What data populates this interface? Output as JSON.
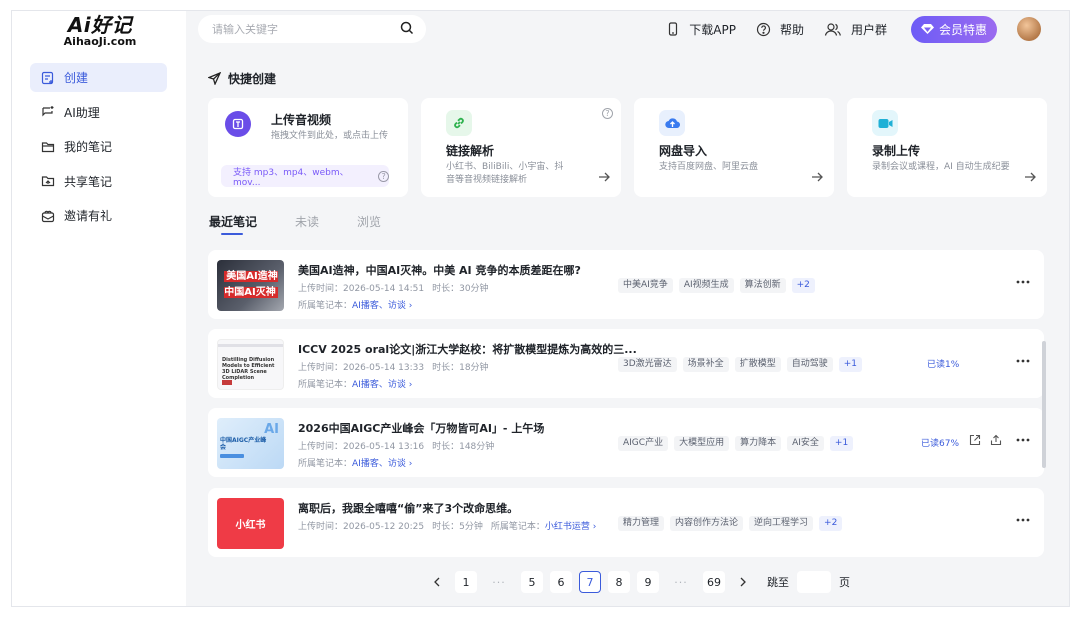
{
  "logo": {
    "mark": "Ai好记",
    "domain": "AihaoJi.com"
  },
  "sidebar": {
    "items": [
      {
        "label": "创建",
        "icon": "create-icon",
        "active": true
      },
      {
        "label": "AI助理",
        "icon": "ai-assistant-icon",
        "active": false
      },
      {
        "label": "我的笔记",
        "icon": "folder-icon",
        "active": false
      },
      {
        "label": "共享笔记",
        "icon": "shared-folder-icon",
        "active": false
      },
      {
        "label": "邀请有礼",
        "icon": "gift-icon",
        "active": false
      }
    ]
  },
  "search": {
    "placeholder": "请输入关键字"
  },
  "topbar": {
    "download_app": "下载APP",
    "help": "帮助",
    "user_group": "用户群",
    "vip": "会员特惠"
  },
  "quick_create": {
    "title": "快捷创建",
    "cards": [
      {
        "title": "上传音视频",
        "desc": "拖拽文件到此处，或点击上传",
        "formats": "支持 mp3、mp4、webm、mov...",
        "icon": "upload-icon"
      },
      {
        "title": "链接解析",
        "desc": "小红书、BiliBili、小宇宙、抖音等音视频链接解析",
        "icon": "link-icon"
      },
      {
        "title": "网盘导入",
        "desc": "支持百度网盘、阿里云盘",
        "icon": "cloud-upload-icon"
      },
      {
        "title": "录制上传",
        "desc": "录制会议或课程，AI 自动生成纪要",
        "icon": "video-record-icon"
      }
    ]
  },
  "tabs": [
    "最近笔记",
    "未读",
    "浏览"
  ],
  "notes": [
    {
      "title": "美国AI造神，中国AI灭神。中美 AI 竞争的本质差距在哪?",
      "upload_time": "上传时间：2026-05-14 14:51",
      "duration": "时长：30分钟",
      "notebook_label": "所属笔记本：",
      "notebook": "AI播客、访谈 ›",
      "tags": [
        "中美AI竞争",
        "AI视频生成",
        "算法创新",
        "+2"
      ],
      "read": "",
      "thumb_text": "美国AI造神 中国AI灭神"
    },
    {
      "title": "ICCV 2025 oral论文|浙江大学赵校：将扩散模型提炼为高效的三...",
      "upload_time": "上传时间：2026-05-14 13:33",
      "duration": "时长：18分钟",
      "notebook_label": "所属笔记本：",
      "notebook": "AI播客、访谈 ›",
      "tags": [
        "3D激光雷达",
        "场景补全",
        "扩散模型",
        "自动驾驶",
        "+1"
      ],
      "read": "已读1%",
      "thumb_text": "Distilling Diffusion Models to Efficient 3D LiDAR Scene Completion"
    },
    {
      "title": "2026中国AIGC产业峰会「万物皆可AI」- 上午场",
      "upload_time": "上传时间：2026-05-14 13:16",
      "duration": "时长：148分钟",
      "notebook_label": "所属笔记本：",
      "notebook": "AI播客、访谈 ›",
      "tags": [
        "AIGC产业",
        "大模型应用",
        "算力降本",
        "AI安全",
        "+1"
      ],
      "read": "已读67%",
      "thumb_text": "中国AIGC产业峰会"
    },
    {
      "title": "离职后，我跟全嘻嘻“偷”来了3个改命思维。",
      "upload_time": "上传时间：2026-05-12 20:25",
      "duration": "时长：5分钟",
      "notebook_label": "所属笔记本：",
      "notebook": "小红书运营 ›",
      "tags": [
        "精力管理",
        "内容创作方法论",
        "逆向工程学习",
        "+2"
      ],
      "read": "",
      "thumb_text": "小红书"
    }
  ],
  "pagination": {
    "pages": [
      "1",
      "···",
      "5",
      "6",
      "7",
      "8",
      "9",
      "···",
      "69"
    ],
    "current": "7",
    "jump_label": "跳至",
    "page_label": "页"
  }
}
